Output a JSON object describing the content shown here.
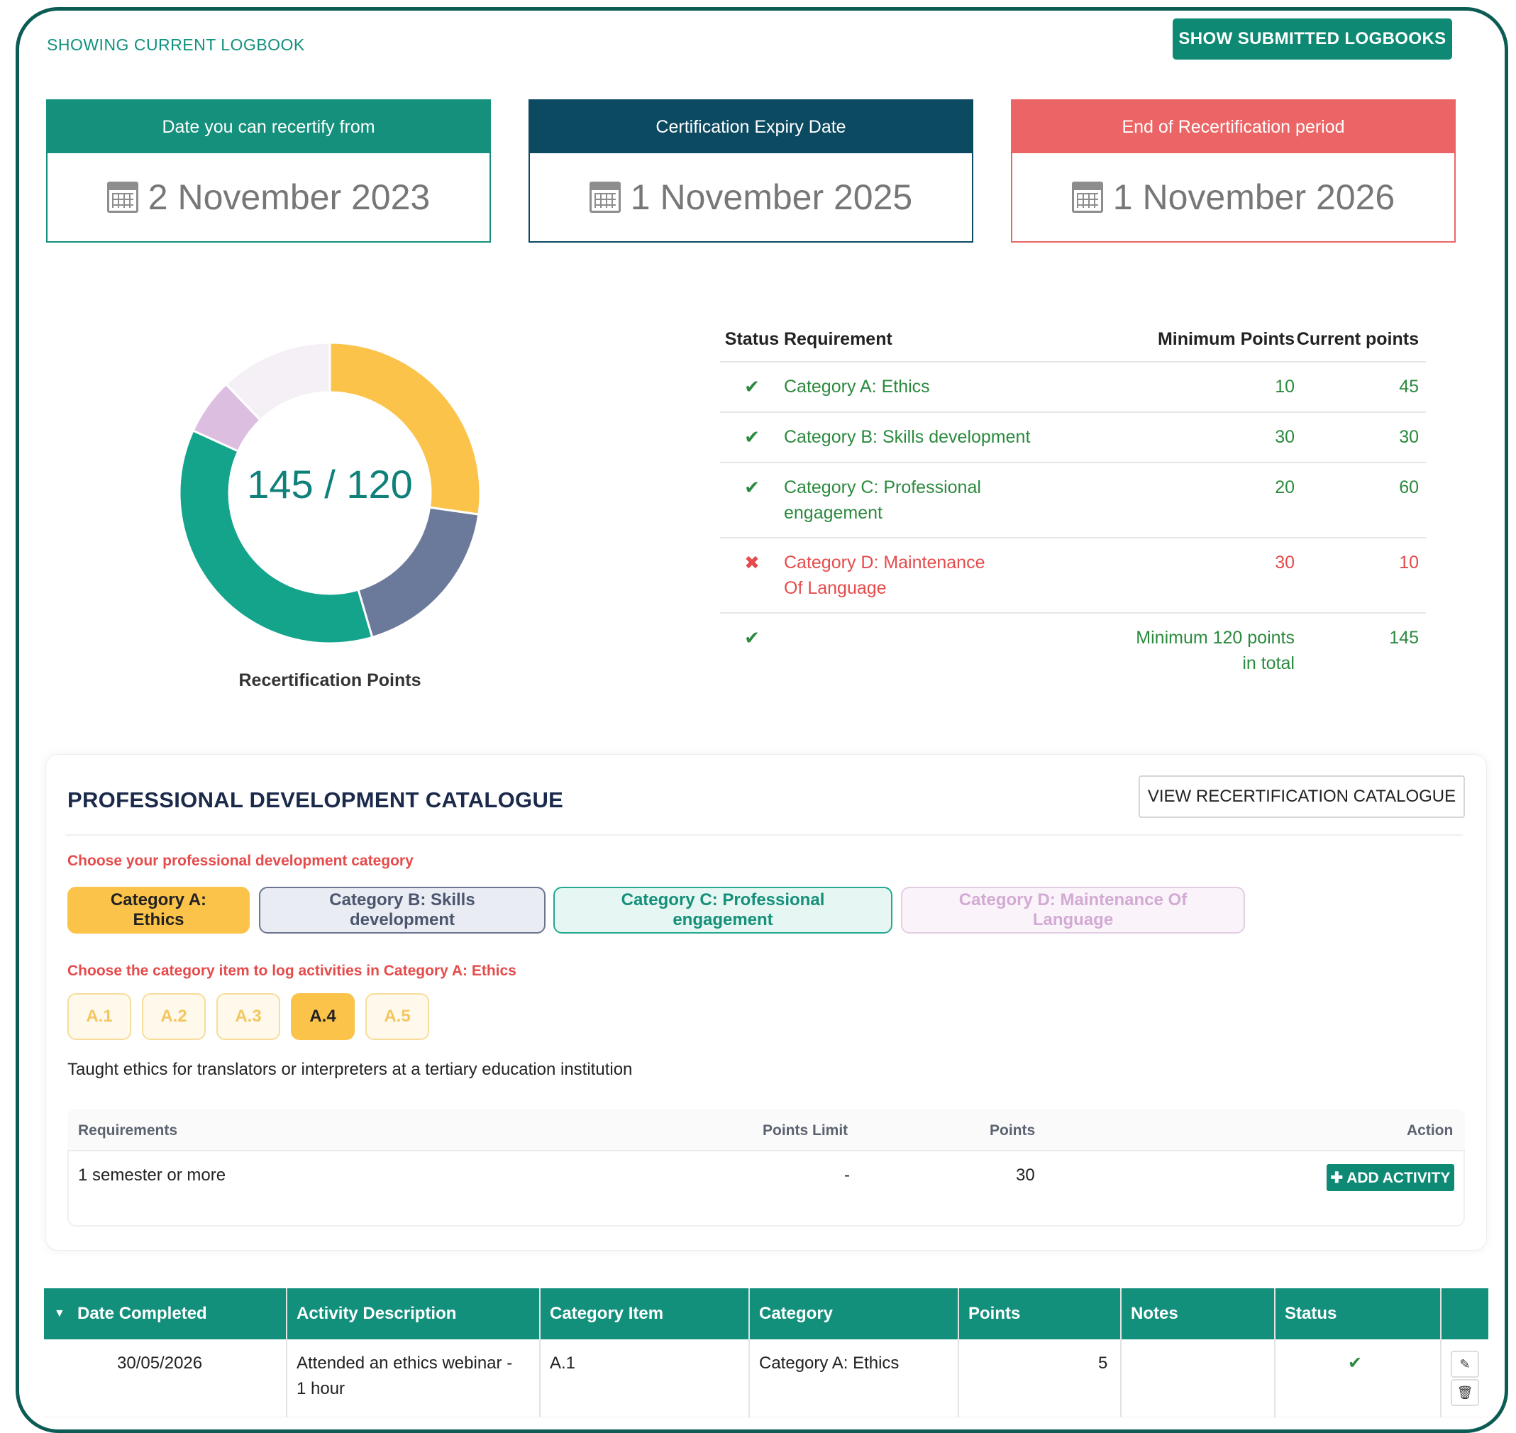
{
  "header": {
    "showing_label": "SHOWING CURRENT LOGBOOK",
    "submitted_button": "SHOW SUBMITTED LOGBOOKS"
  },
  "date_cards": [
    {
      "title": "Date you can recertify from",
      "date": "2 November 2023",
      "icon": "calendar-icon",
      "color": "#14907c"
    },
    {
      "title": "Certification Expiry Date",
      "date": "1 November 2025",
      "icon": "calendar-icon",
      "color": "#0c4a62"
    },
    {
      "title": "End of Recertification period",
      "date": "1 November 2026",
      "icon": "calendar-icon",
      "color": "#ec6566"
    }
  ],
  "donut": {
    "center_text": "145 / 120",
    "title": "Recertification Points",
    "segments": [
      {
        "category": "Category A: Ethics",
        "value": 45,
        "color": "#fbc34a"
      },
      {
        "category": "Category B: Skills development",
        "value": 30,
        "color": "#6b7a9b"
      },
      {
        "category": "Category C: Professional engagement",
        "value": 60,
        "color": "#14a48c"
      },
      {
        "category": "Category D: Maintenance Of Language",
        "value": 10,
        "color": "#dcbfe0"
      },
      {
        "category": "remaining",
        "value": 20,
        "color": "#f4f0f6"
      }
    ]
  },
  "requirements_table": {
    "headers": {
      "status": "Status",
      "requirement": "Requirement",
      "min": "Minimum Points",
      "current": "Current points"
    },
    "rows": [
      {
        "status": "ok",
        "status_icon": "check-icon",
        "requirement": "Category A: Ethics",
        "min": "10",
        "current": "45"
      },
      {
        "status": "ok",
        "status_icon": "check-icon",
        "requirement": "Category B: Skills development",
        "min": "30",
        "current": "30"
      },
      {
        "status": "ok",
        "status_icon": "check-icon",
        "requirement": "Category C: Professional engagement",
        "min": "20",
        "current": "60"
      },
      {
        "status": "bad",
        "status_icon": "cross-icon",
        "requirement": "Category D: Maintenance Of Language",
        "min": "30",
        "current": "10"
      }
    ],
    "total": {
      "status_icon": "check-icon",
      "min_line1": "Minimum 120 points",
      "min_line2": "in total",
      "current": "145"
    }
  },
  "catalogue": {
    "title": "PROFESSIONAL DEVELOPMENT CATALOGUE",
    "view_button": "VIEW RECERTIFICATION CATALOGUE",
    "choose_category_label": "Choose your professional development category",
    "categories": [
      "Category A: Ethics",
      "Category B: Skills development",
      "Category C: Professional engagement",
      "Category D: Maintenance Of Language"
    ],
    "choose_item_label": "Choose the category item to log activities in Category A: Ethics",
    "items": [
      "A.1",
      "A.2",
      "A.3",
      "A.4",
      "A.5"
    ],
    "selected_item": "A.4",
    "item_description": "Taught ethics for translators or interpreters at a tertiary education institution",
    "table": {
      "headers": {
        "requirements": "Requirements",
        "limit": "Points Limit",
        "points": "Points",
        "action": "Action"
      },
      "row": {
        "requirement": "1 semester or more",
        "limit": "-",
        "points": "30",
        "action": "ADD ACTIVITY",
        "action_icon": "plus-icon"
      }
    }
  },
  "log_table": {
    "sort_icon": "caret-down-icon",
    "headers": [
      "Date Completed",
      "Activity Description",
      "Category Item",
      "Category",
      "Points",
      "Notes",
      "Status"
    ],
    "rows": [
      {
        "date": "30/05/2026",
        "description_line1": "Attended an ethics webinar -",
        "description_line2": "1 hour",
        "item": "A.1",
        "category": "Category A: Ethics",
        "points": "5",
        "notes": "",
        "status_icon": "check-icon",
        "edit_icon": "edit-icon",
        "delete_icon": "trash-icon"
      }
    ]
  }
}
